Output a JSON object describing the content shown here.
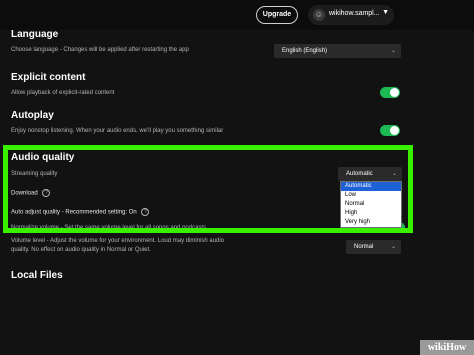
{
  "header": {
    "upgrade_label": "Upgrade",
    "username": "wikihow.sampl...",
    "user_icon": "user-icon",
    "caret_icon": "chevron-down-icon"
  },
  "language": {
    "title": "Language",
    "desc": "Choose language - Changes will be applied after restarting the app",
    "selected": "English (English)"
  },
  "explicit": {
    "title": "Explicit content",
    "desc": "Allow playback of explicit-rated content",
    "enabled": true
  },
  "autoplay": {
    "title": "Autoplay",
    "desc": "Enjoy nonstop listening. When your audio ends, we'll play you something similar",
    "enabled": true
  },
  "audio_quality": {
    "title": "Audio quality",
    "streaming_label": "Streaming quality",
    "streaming_selected": "Automatic",
    "download_label": "Download",
    "auto_adjust_label": "Auto adjust quality - Recommended setting: On",
    "normalize_label": "Normalize volume - Set the same volume level for all songs and podcasts",
    "volume_label_line1": "Volume level - Adjust the volume for your environment. Loud may diminish audio",
    "volume_label_line2": "quality. No effect on audio quality in Normal or Quiet.",
    "volume_selected": "Normal",
    "options": [
      "Automatic",
      "Low",
      "Normal",
      "High",
      "Very high"
    ]
  },
  "local_files": {
    "title": "Local Files"
  },
  "watermark": {
    "wiki": "wiki",
    "how": "How"
  },
  "colors": {
    "highlight": "#39f000",
    "toggle_on": "#1db954",
    "option_selected": "#1e60d6"
  }
}
